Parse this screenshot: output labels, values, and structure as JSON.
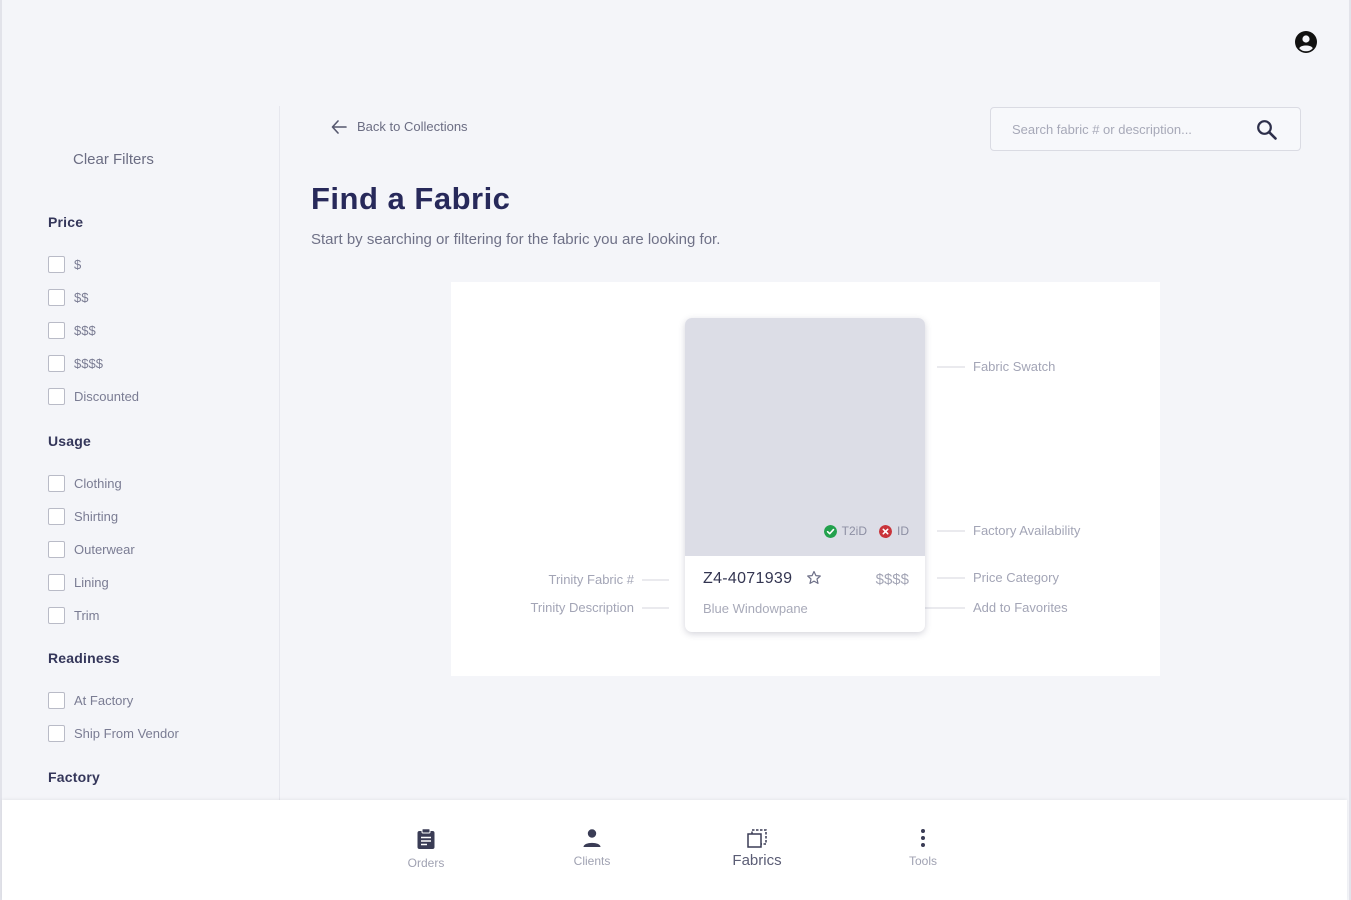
{
  "header": {
    "account_icon": "account-circle-icon"
  },
  "sidebar": {
    "clear_filters": "Clear Filters",
    "groups": [
      {
        "title": "Price",
        "options": [
          "$",
          "$$",
          "$$$",
          "$$$$",
          "Discounted"
        ]
      },
      {
        "title": "Usage",
        "options": [
          "Clothing",
          "Shirting",
          "Outerwear",
          "Lining",
          "Trim"
        ]
      },
      {
        "title": "Readiness",
        "options": [
          "At Factory",
          "Ship From Vendor"
        ]
      },
      {
        "title": "Factory",
        "options": []
      }
    ]
  },
  "main": {
    "back_link": "Back to Collections",
    "search_placeholder": "Search fabric # or description...",
    "title": "Find a Fabric",
    "subtitle": "Start by searching or filtering for the fabric you are looking for."
  },
  "legend": {
    "card": {
      "fabric_number": "Z4-4071939",
      "price_category": "$$$$",
      "description": "Blue Windowpane",
      "availability": [
        {
          "label": "T2iD",
          "status": "available",
          "color": "#23a14d"
        },
        {
          "label": "ID",
          "status": "unavailable",
          "color": "#c9333a"
        }
      ]
    },
    "callouts": {
      "fabric_swatch": "Fabric Swatch",
      "factory_availability": "Factory Availability",
      "price_category": "Price Category",
      "add_to_favorites": "Add to Favorites",
      "trinity_fabric_number": "Trinity Fabric #",
      "trinity_description": "Trinity Description"
    }
  },
  "bottom_nav": {
    "items": [
      {
        "label": "Orders",
        "icon": "clipboard-icon",
        "active": false
      },
      {
        "label": "Clients",
        "icon": "person-icon",
        "active": false
      },
      {
        "label": "Fabrics",
        "icon": "fabric-swatch-icon",
        "active": true
      },
      {
        "label": "Tools",
        "icon": "more-vertical-icon",
        "active": false
      }
    ]
  }
}
